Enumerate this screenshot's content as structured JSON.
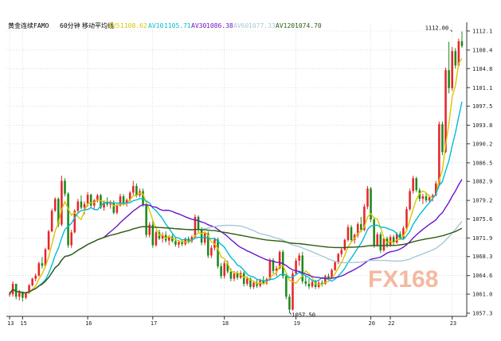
{
  "title_bar": {
    "symbol": "黄金连续FAMO",
    "period": "60分钟",
    "study": "移动平均线",
    "ma5": {
      "label": "AV5",
      "value": "1108.62",
      "color": "#d8c800"
    },
    "ma10": {
      "label": "AV10",
      "value": "1105.71",
      "color": "#00bcd4"
    },
    "ma30": {
      "label": "AV30",
      "value": "1086.38",
      "color": "#6a16c8"
    },
    "ma60": {
      "label": "AV60",
      "value": "1077.33",
      "color": "#a8c8d4"
    },
    "ma120": {
      "label": "AV120",
      "value": "1074.70",
      "color": "#2e5d12"
    }
  },
  "watermark": {
    "text": "FX168",
    "color_fx": "#f4b9a0",
    "color_num": "#c0c8d4"
  },
  "colors": {
    "up": "#e8242a",
    "down": "#1a8a1a",
    "grid": "#c8c8c8",
    "axis": "#333333"
  },
  "chart_data": {
    "type": "candlestick",
    "ylim": [
      1057.3,
      1112.1
    ],
    "y_ticks": [
      "1112.1",
      "1108.4",
      "1104.8",
      "1101.1",
      "1097.5",
      "1093.8",
      "1090.2",
      "1086.5",
      "1082.9",
      "1079.2",
      "1075.6",
      "1071.9",
      "1068.3",
      "1064.6",
      "1061.0",
      "1057.3"
    ],
    "x_ticks": [
      {
        "label": "13",
        "bar": 0
      },
      {
        "label": "15",
        "bar": 4
      },
      {
        "label": "16",
        "bar": 24
      },
      {
        "label": "17",
        "bar": 44
      },
      {
        "label": "18",
        "bar": 66
      },
      {
        "label": "19",
        "bar": 88
      },
      {
        "label": "20",
        "bar": 111
      },
      {
        "label": "22",
        "bar": 117
      },
      {
        "label": "23",
        "bar": 136
      }
    ],
    "annotations": [
      {
        "text": "1112.00",
        "bar": 136,
        "value": 1112.0
      },
      {
        "text": "1057.50",
        "bar": 86,
        "value": 1057.5
      }
    ],
    "candles": [
      [
        1061.0,
        1061.5,
        1060.5,
        1061.0
      ],
      [
        1061.0,
        1063.5,
        1060.5,
        1063.0
      ],
      [
        1063.0,
        1062.5,
        1060.0,
        1060.5
      ],
      [
        1060.5,
        1061.8,
        1059.8,
        1061.5
      ],
      [
        1061.5,
        1061.5,
        1059.6,
        1060.3
      ],
      [
        1060.3,
        1061.5,
        1060.0,
        1061.2
      ],
      [
        1061.2,
        1063.0,
        1061.0,
        1062.7
      ],
      [
        1062.7,
        1064.2,
        1062.5,
        1064.0
      ],
      [
        1064.0,
        1065.0,
        1063.5,
        1064.6
      ],
      [
        1064.6,
        1067.3,
        1064.4,
        1067.0
      ],
      [
        1067.0,
        1068.2,
        1066.0,
        1066.5
      ],
      [
        1066.5,
        1070.0,
        1066.2,
        1069.7
      ],
      [
        1069.7,
        1073.5,
        1069.5,
        1073.2
      ],
      [
        1073.2,
        1077.6,
        1073.0,
        1077.2
      ],
      [
        1077.2,
        1079.8,
        1077.0,
        1079.5
      ],
      [
        1079.5,
        1079.8,
        1074.0,
        1074.5
      ],
      [
        1074.5,
        1084.0,
        1074.2,
        1083.0
      ],
      [
        1083.0,
        1083.5,
        1080.0,
        1080.5
      ],
      [
        1080.5,
        1080.8,
        1070.0,
        1070.5
      ],
      [
        1070.5,
        1073.5,
        1070.0,
        1073.0
      ],
      [
        1073.0,
        1077.5,
        1072.8,
        1077.2
      ],
      [
        1077.2,
        1079.5,
        1076.8,
        1079.0
      ],
      [
        1079.0,
        1080.2,
        1077.5,
        1077.8
      ],
      [
        1077.8,
        1079.0,
        1076.5,
        1078.5
      ],
      [
        1078.5,
        1080.8,
        1078.0,
        1080.3
      ],
      [
        1080.3,
        1080.5,
        1077.8,
        1078.2
      ],
      [
        1078.2,
        1079.5,
        1077.5,
        1079.2
      ],
      [
        1079.2,
        1080.5,
        1078.8,
        1080.2
      ],
      [
        1080.2,
        1080.5,
        1077.5,
        1077.8
      ],
      [
        1077.8,
        1079.2,
        1077.2,
        1078.9
      ],
      [
        1078.9,
        1079.8,
        1078.0,
        1078.4
      ],
      [
        1078.4,
        1079.2,
        1077.6,
        1078.8
      ],
      [
        1078.8,
        1079.2,
        1076.5,
        1076.8
      ],
      [
        1076.8,
        1078.5,
        1076.5,
        1078.2
      ],
      [
        1078.2,
        1080.5,
        1078.0,
        1080.0
      ],
      [
        1080.0,
        1080.4,
        1078.2,
        1078.5
      ],
      [
        1078.5,
        1079.6,
        1078.0,
        1079.3
      ],
      [
        1079.3,
        1081.0,
        1079.0,
        1080.7
      ],
      [
        1080.7,
        1083.0,
        1080.2,
        1082.0
      ],
      [
        1082.0,
        1082.5,
        1079.8,
        1080.2
      ],
      [
        1080.2,
        1081.5,
        1079.8,
        1081.0
      ],
      [
        1081.0,
        1081.5,
        1078.0,
        1078.4
      ],
      [
        1078.4,
        1078.8,
        1072.0,
        1072.5
      ],
      [
        1072.5,
        1075.0,
        1072.0,
        1074.5
      ],
      [
        1074.5,
        1075.5,
        1070.0,
        1070.5
      ],
      [
        1070.5,
        1073.3,
        1070.2,
        1073.0
      ],
      [
        1073.0,
        1073.5,
        1071.5,
        1071.8
      ],
      [
        1071.8,
        1073.0,
        1071.0,
        1072.5
      ],
      [
        1072.5,
        1073.2,
        1071.0,
        1071.4
      ],
      [
        1071.4,
        1072.5,
        1070.5,
        1072.2
      ],
      [
        1072.2,
        1072.6,
        1071.0,
        1071.3
      ],
      [
        1071.3,
        1072.0,
        1070.2,
        1070.6
      ],
      [
        1070.6,
        1071.5,
        1070.0,
        1071.1
      ],
      [
        1071.1,
        1071.4,
        1070.3,
        1070.7
      ],
      [
        1070.7,
        1072.0,
        1070.4,
        1071.8
      ],
      [
        1071.8,
        1072.2,
        1070.8,
        1071.2
      ],
      [
        1071.2,
        1072.4,
        1070.9,
        1072.1
      ],
      [
        1072.1,
        1076.5,
        1071.8,
        1076.0
      ],
      [
        1076.0,
        1076.3,
        1073.0,
        1073.5
      ],
      [
        1073.5,
        1074.0,
        1070.5,
        1071.0
      ],
      [
        1071.0,
        1073.2,
        1070.5,
        1072.8
      ],
      [
        1072.8,
        1073.2,
        1068.0,
        1068.5
      ],
      [
        1068.5,
        1070.5,
        1068.0,
        1070.0
      ],
      [
        1070.0,
        1072.0,
        1069.5,
        1071.6
      ],
      [
        1071.6,
        1072.0,
        1066.0,
        1066.4
      ],
      [
        1066.4,
        1067.0,
        1064.0,
        1064.5
      ],
      [
        1064.5,
        1067.5,
        1064.0,
        1067.0
      ],
      [
        1067.0,
        1067.5,
        1065.0,
        1065.4
      ],
      [
        1065.4,
        1066.0,
        1063.5,
        1064.0
      ],
      [
        1064.0,
        1065.5,
        1063.5,
        1065.0
      ],
      [
        1065.0,
        1065.5,
        1063.8,
        1064.2
      ],
      [
        1064.2,
        1065.6,
        1063.9,
        1065.1
      ],
      [
        1065.1,
        1065.4,
        1062.5,
        1063.0
      ],
      [
        1063.0,
        1064.5,
        1062.6,
        1064.0
      ],
      [
        1064.0,
        1064.2,
        1062.0,
        1062.4
      ],
      [
        1062.4,
        1063.5,
        1062.0,
        1063.2
      ],
      [
        1063.2,
        1063.8,
        1062.2,
        1062.6
      ],
      [
        1062.6,
        1064.0,
        1062.3,
        1063.7
      ],
      [
        1063.7,
        1064.5,
        1062.8,
        1063.1
      ],
      [
        1063.1,
        1064.2,
        1062.8,
        1063.9
      ],
      [
        1063.9,
        1068.0,
        1063.6,
        1067.6
      ],
      [
        1067.6,
        1068.0,
        1065.0,
        1065.5
      ],
      [
        1065.5,
        1066.5,
        1064.5,
        1066.0
      ],
      [
        1066.0,
        1069.5,
        1065.8,
        1069.2
      ],
      [
        1069.2,
        1069.6,
        1064.0,
        1064.5
      ],
      [
        1064.5,
        1065.0,
        1060.0,
        1060.5
      ],
      [
        1060.5,
        1061.0,
        1057.5,
        1058.0
      ],
      [
        1058.0,
        1065.5,
        1057.8,
        1065.0
      ],
      [
        1065.0,
        1068.0,
        1064.8,
        1067.5
      ],
      [
        1067.5,
        1069.0,
        1066.5,
        1068.5
      ],
      [
        1068.5,
        1069.2,
        1063.0,
        1063.5
      ],
      [
        1063.5,
        1064.5,
        1062.5,
        1063.0
      ],
      [
        1063.0,
        1064.0,
        1062.0,
        1062.5
      ],
      [
        1062.5,
        1063.8,
        1062.2,
        1063.4
      ],
      [
        1063.4,
        1063.8,
        1062.0,
        1062.4
      ],
      [
        1062.4,
        1063.6,
        1062.1,
        1063.2
      ],
      [
        1063.2,
        1063.7,
        1062.5,
        1063.0
      ],
      [
        1063.0,
        1064.8,
        1062.8,
        1064.5
      ],
      [
        1064.5,
        1065.0,
        1063.8,
        1064.2
      ],
      [
        1064.2,
        1066.0,
        1064.0,
        1065.7
      ],
      [
        1065.7,
        1067.5,
        1065.5,
        1067.2
      ],
      [
        1067.2,
        1069.0,
        1066.8,
        1068.8
      ],
      [
        1068.8,
        1070.0,
        1068.2,
        1069.6
      ],
      [
        1069.6,
        1071.8,
        1069.4,
        1071.5
      ],
      [
        1071.5,
        1074.5,
        1071.2,
        1074.0
      ],
      [
        1074.0,
        1074.4,
        1071.0,
        1071.5
      ],
      [
        1071.5,
        1072.8,
        1070.8,
        1072.5
      ],
      [
        1072.5,
        1075.0,
        1072.0,
        1074.6
      ],
      [
        1074.6,
        1076.0,
        1073.0,
        1073.5
      ],
      [
        1073.5,
        1078.5,
        1073.2,
        1078.0
      ],
      [
        1078.0,
        1082.0,
        1077.5,
        1081.5
      ],
      [
        1081.5,
        1081.8,
        1075.0,
        1075.5
      ],
      [
        1075.5,
        1076.0,
        1070.0,
        1070.5
      ],
      [
        1070.5,
        1073.0,
        1070.2,
        1072.6
      ],
      [
        1072.6,
        1073.0,
        1069.0,
        1069.5
      ],
      [
        1069.5,
        1072.0,
        1069.2,
        1071.8
      ],
      [
        1071.8,
        1072.2,
        1070.0,
        1070.4
      ],
      [
        1070.4,
        1072.5,
        1070.2,
        1072.1
      ],
      [
        1072.1,
        1072.5,
        1070.5,
        1071.0
      ],
      [
        1071.0,
        1073.0,
        1070.8,
        1072.7
      ],
      [
        1072.7,
        1073.2,
        1071.5,
        1071.9
      ],
      [
        1071.9,
        1074.2,
        1071.6,
        1073.8
      ],
      [
        1073.8,
        1078.0,
        1073.5,
        1077.5
      ],
      [
        1077.5,
        1081.5,
        1077.2,
        1081.0
      ],
      [
        1081.0,
        1084.0,
        1080.5,
        1083.5
      ],
      [
        1083.5,
        1083.8,
        1080.8,
        1081.2
      ],
      [
        1081.2,
        1081.6,
        1079.0,
        1079.5
      ],
      [
        1079.5,
        1080.5,
        1078.5,
        1080.0
      ],
      [
        1080.0,
        1080.6,
        1078.8,
        1079.2
      ],
      [
        1079.2,
        1080.2,
        1078.9,
        1079.8
      ],
      [
        1079.8,
        1080.5,
        1079.0,
        1080.2
      ],
      [
        1080.2,
        1083.0,
        1080.0,
        1082.5
      ],
      [
        1082.5,
        1094.5,
        1082.2,
        1094.0
      ],
      [
        1094.0,
        1094.5,
        1088.0,
        1088.6
      ],
      [
        1088.6,
        1105.0,
        1088.4,
        1104.5
      ],
      [
        1104.5,
        1110.0,
        1100.0,
        1101.0
      ],
      [
        1101.0,
        1109.0,
        1100.5,
        1108.2
      ],
      [
        1108.2,
        1108.8,
        1104.8,
        1105.4
      ],
      [
        1105.4,
        1110.6,
        1105.2,
        1110.1
      ],
      [
        1110.1,
        1112.0,
        1108.8,
        1109.2
      ]
    ],
    "series": [
      {
        "name": "AV5",
        "color": "#d8c800",
        "period": 5
      },
      {
        "name": "AV10",
        "color": "#00bcd4",
        "period": 10
      },
      {
        "name": "AV30",
        "color": "#6a16c8",
        "period": 30
      },
      {
        "name": "AV60",
        "color": "#a8c8d4",
        "period": 60
      },
      {
        "name": "AV120",
        "color": "#2e5d12",
        "period": 120
      }
    ]
  }
}
